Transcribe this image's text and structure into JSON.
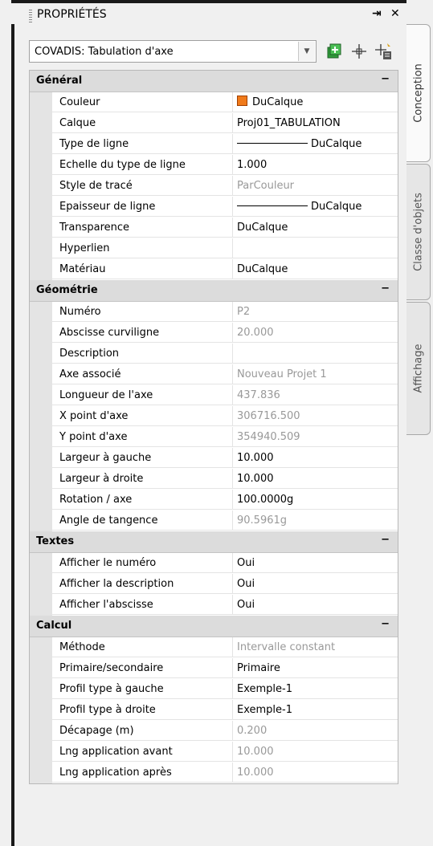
{
  "panel": {
    "title": "PROPRIÉTÉS"
  },
  "selector": {
    "value": "COVADIS: Tabulation d'axe"
  },
  "tabs": [
    {
      "label": "Conception"
    },
    {
      "label": "Classe d'objets"
    },
    {
      "label": "Affichage"
    }
  ],
  "general": {
    "label": "Général",
    "collapse": "−",
    "rows": [
      {
        "name": "Couleur",
        "value": "DuCalque",
        "color": "#f07a1a"
      },
      {
        "name": "Calque",
        "value": "Proj01_TABULATION"
      },
      {
        "name": "Type de ligne",
        "value": "DuCalque"
      },
      {
        "name": "Echelle du type de ligne",
        "value": "1.000"
      },
      {
        "name": "Style de tracé",
        "value": "ParCouleur"
      },
      {
        "name": "Epaisseur de ligne",
        "value": "DuCalque"
      },
      {
        "name": "Transparence",
        "value": "DuCalque"
      },
      {
        "name": "Hyperlien",
        "value": ""
      },
      {
        "name": "Matériau",
        "value": "DuCalque"
      }
    ]
  },
  "geometrie": {
    "label": "Géométrie",
    "collapse": "−",
    "rows": [
      {
        "name": "Numéro",
        "value": "P2"
      },
      {
        "name": "Abscisse curviligne",
        "value": "20.000"
      },
      {
        "name": "Description",
        "value": ""
      },
      {
        "name": "Axe associé",
        "value": "Nouveau Projet 1"
      },
      {
        "name": "Longueur de l'axe",
        "value": "437.836"
      },
      {
        "name": "X point d'axe",
        "value": "306716.500"
      },
      {
        "name": "Y point d'axe",
        "value": "354940.509"
      },
      {
        "name": "Largeur à gauche",
        "value": "10.000"
      },
      {
        "name": "Largeur à droite",
        "value": "10.000"
      },
      {
        "name": "Rotation / axe",
        "value": "100.0000g"
      },
      {
        "name": "Angle de tangence",
        "value": "90.5961g"
      }
    ]
  },
  "textes": {
    "label": "Textes",
    "collapse": "−",
    "rows": [
      {
        "name": "Afficher le numéro",
        "value": "Oui"
      },
      {
        "name": "Afficher la description",
        "value": "Oui"
      },
      {
        "name": "Afficher l'abscisse",
        "value": "Oui"
      }
    ]
  },
  "calcul": {
    "label": "Calcul",
    "collapse": "−",
    "rows": [
      {
        "name": "Méthode",
        "value": "Intervalle constant"
      },
      {
        "name": "Primaire/secondaire",
        "value": "Primaire"
      },
      {
        "name": "Profil type à gauche",
        "value": "Exemple-1"
      },
      {
        "name": "Profil type à droite",
        "value": "Exemple-1"
      },
      {
        "name": "Décapage (m)",
        "value": "0.200"
      },
      {
        "name": "Lng application avant",
        "value": "10.000"
      },
      {
        "name": "Lng application après",
        "value": "10.000"
      }
    ]
  }
}
